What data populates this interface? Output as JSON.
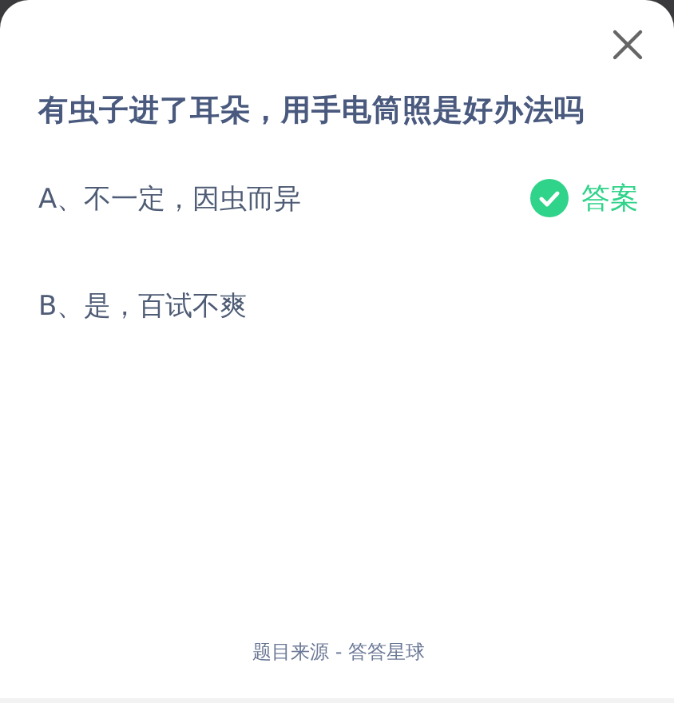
{
  "question": "有虫子进了耳朵，用手电筒照是好办法吗",
  "options": [
    {
      "label": "A、不一定，因虫而异",
      "correct": true
    },
    {
      "label": "B、是，百试不爽",
      "correct": false
    }
  ],
  "answer_label": "答案",
  "footer": "题目来源 - 答答星球"
}
